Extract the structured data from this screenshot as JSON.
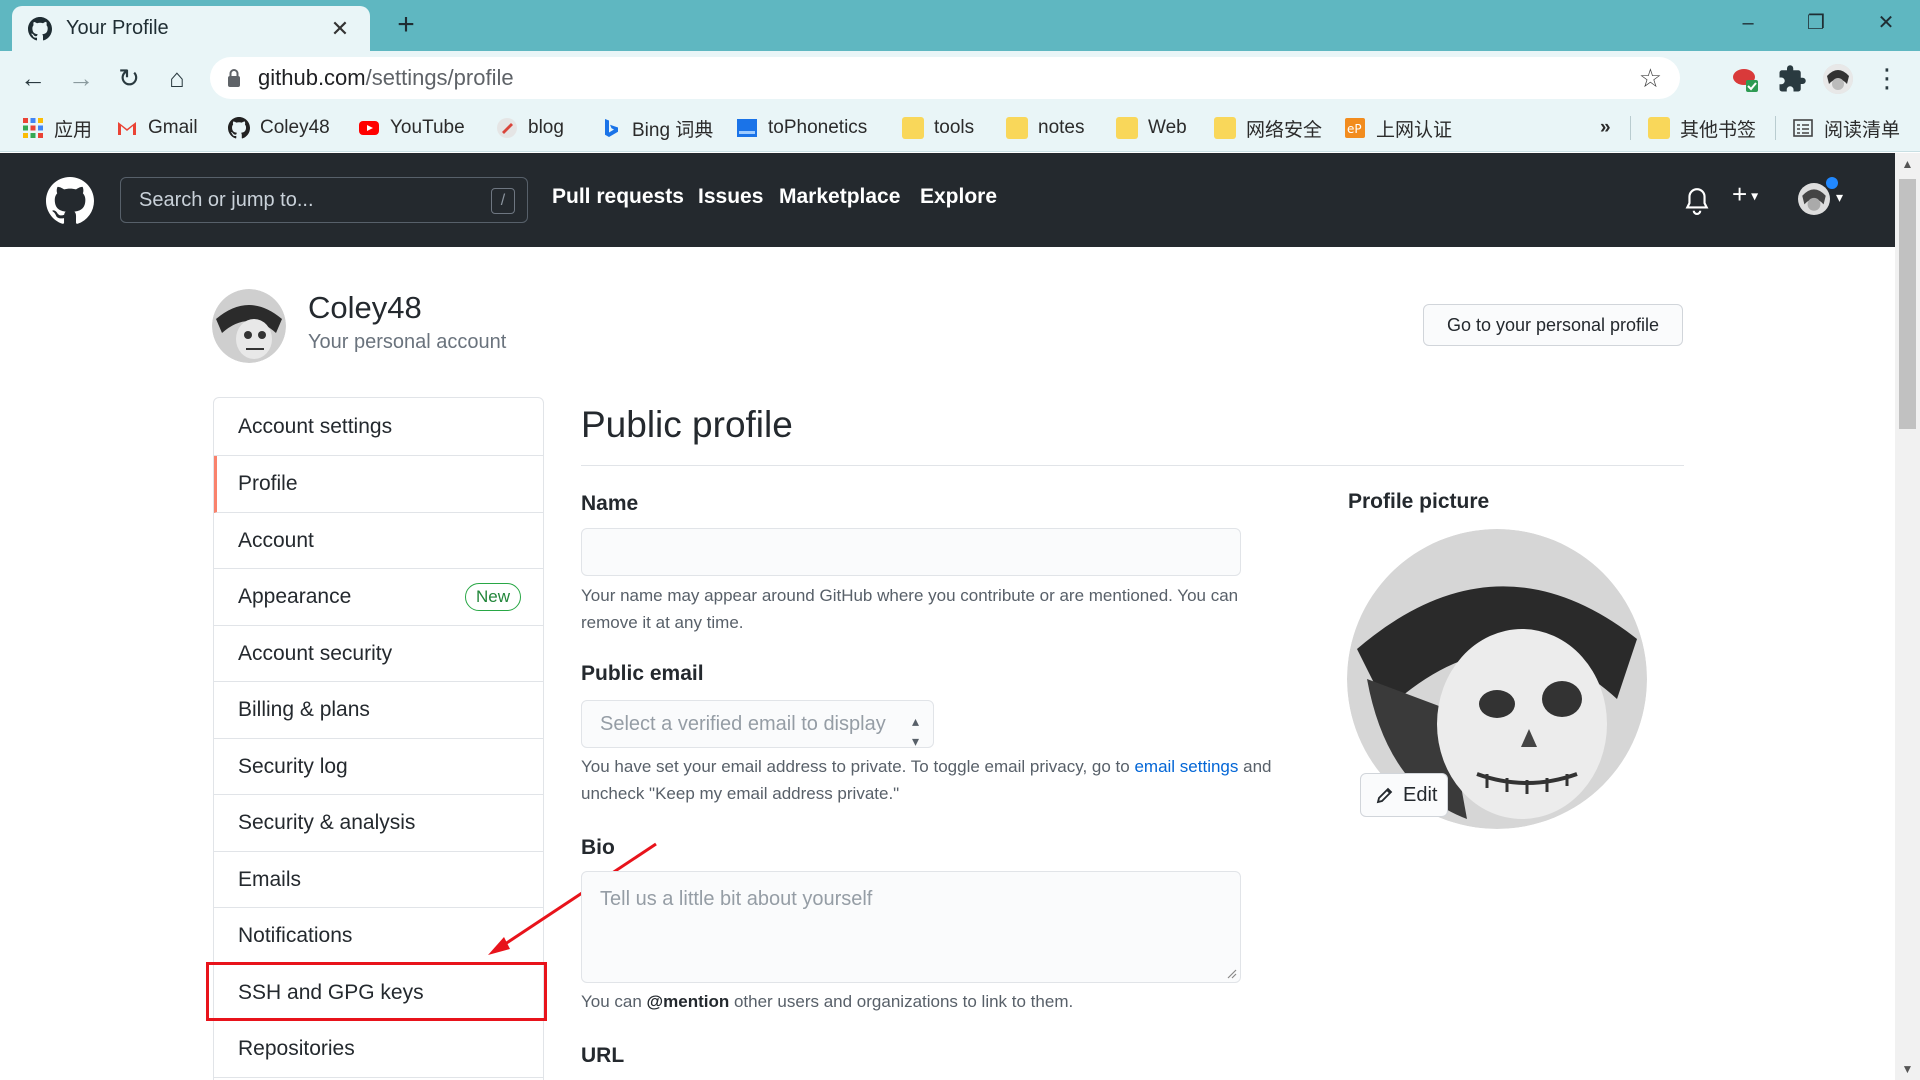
{
  "browser": {
    "tab_title": "Your Profile",
    "new_tab_symbol": "+",
    "url_host": "github.com",
    "url_path": "/settings/profile",
    "bookmarks": [
      {
        "label": "应用"
      },
      {
        "label": "Gmail"
      },
      {
        "label": "Coley48"
      },
      {
        "label": "YouTube"
      },
      {
        "label": "blog"
      },
      {
        "label": "Bing 词典"
      },
      {
        "label": "toPhonetics"
      },
      {
        "label": "tools"
      },
      {
        "label": "notes"
      },
      {
        "label": "Web"
      },
      {
        "label": "网络安全"
      },
      {
        "label": "上网认证"
      }
    ],
    "overflow_symbol": "»",
    "other_bookmarks": "其他书签",
    "reading_list": "阅读清单"
  },
  "github_header": {
    "search_placeholder": "Search or jump to...",
    "search_shortcut": "/",
    "nav": [
      "Pull requests",
      "Issues",
      "Marketplace",
      "Explore"
    ],
    "plus_symbol": "+"
  },
  "account": {
    "username": "Coley48",
    "subtitle": "Your personal account",
    "go_to_profile_button": "Go to your personal profile"
  },
  "sidebar": {
    "heading": "Account settings",
    "items": [
      {
        "label": "Profile",
        "active": true
      },
      {
        "label": "Account"
      },
      {
        "label": "Appearance",
        "badge": "New"
      },
      {
        "label": "Account security"
      },
      {
        "label": "Billing & plans"
      },
      {
        "label": "Security log"
      },
      {
        "label": "Security & analysis"
      },
      {
        "label": "Emails"
      },
      {
        "label": "Notifications"
      },
      {
        "label": "SSH and GPG keys",
        "highlighted": true
      },
      {
        "label": "Repositories"
      }
    ]
  },
  "profile_form": {
    "title": "Public profile",
    "name_label": "Name",
    "name_value": "",
    "name_note": "Your name may appear around GitHub where you contribute or are mentioned. You can remove it at any time.",
    "email_label": "Public email",
    "email_select_placeholder": "Select a verified email to display",
    "email_note_before": "You have set your email address to private. To toggle email privacy, go to ",
    "email_note_link": "email settings",
    "email_note_after": " and uncheck \"Keep my email address private.\"",
    "bio_label": "Bio",
    "bio_placeholder": "Tell us a little bit about yourself",
    "bio_note_before": "You can ",
    "bio_note_mention": "@mention",
    "bio_note_after": " other users and organizations to link to them.",
    "url_label": "URL"
  },
  "profile_picture": {
    "label": "Profile picture",
    "edit_button": "Edit"
  },
  "colors": {
    "tabstrip": "#5fb7c1",
    "header": "#24292e",
    "accent_active": "#f9826c",
    "badge_green": "#28a745",
    "highlight_red": "#e8131b",
    "link_blue": "#0366d6"
  }
}
